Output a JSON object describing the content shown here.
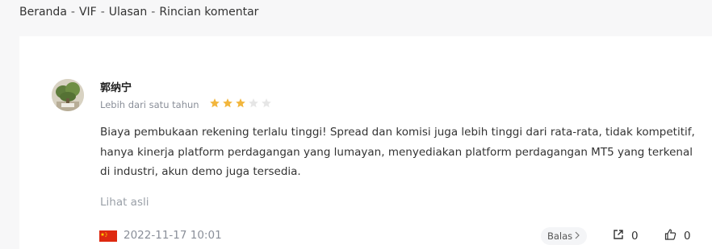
{
  "breadcrumb": {
    "items": [
      "Beranda",
      "VIF",
      "Ulasan",
      "Rincian komentar"
    ],
    "separator": "-"
  },
  "review": {
    "username": "郭纳宁",
    "time_ago": "Lebih dari satu tahun",
    "rating": 3,
    "rating_max": 5,
    "star_color_on": "#f2b63d",
    "star_color_off": "#e6e6e6",
    "comment": "Biaya pembukaan rekening terlalu tinggi! Spread dan komisi juga lebih tinggi dari rata-rata, tidak kompetitif, hanya kinerja platform perdagangan yang lumayan, menyediakan platform perdagangan MT5 yang terkenal di industri, akun demo juga tersedia.",
    "view_original": "Lihat asli",
    "flag": "china-flag-icon",
    "datetime": "2022-11-17 10:01",
    "reply_label": "Balas",
    "share_count": "0",
    "like_count": "0"
  }
}
